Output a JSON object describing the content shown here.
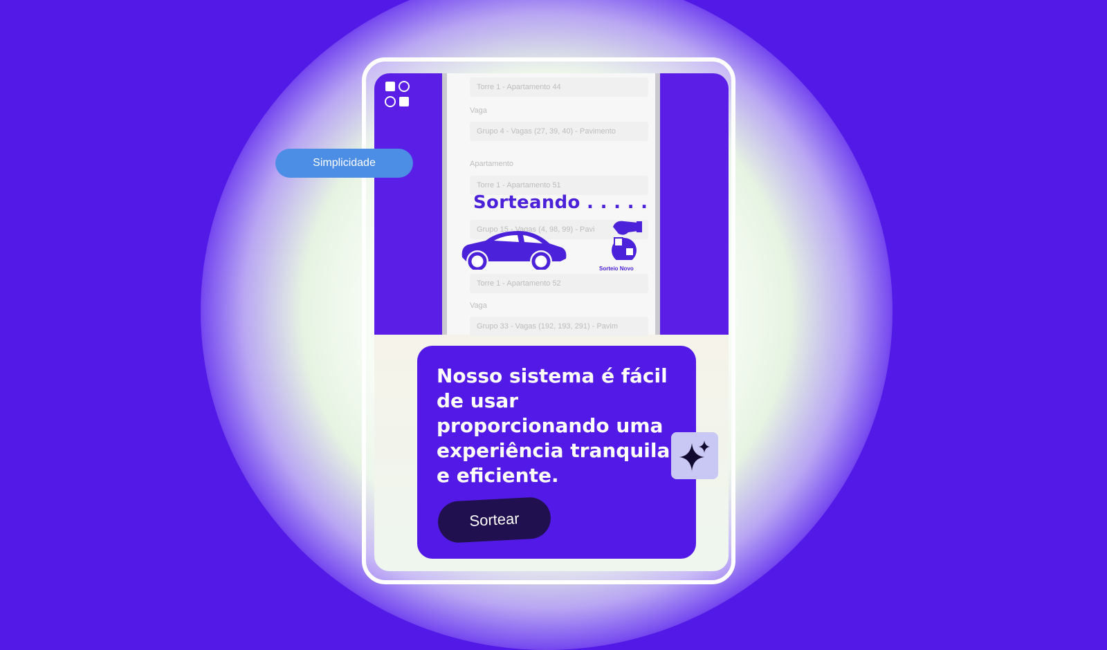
{
  "badge": {
    "label": "Simplicidade"
  },
  "video": {
    "form_rows": [
      {
        "type": "field",
        "text": "Torre 1 - Apartamento 44"
      },
      {
        "type": "label",
        "text": "Vaga"
      },
      {
        "type": "field",
        "text": "Grupo 4 - Vagas (27, 39, 40) - Pavimento"
      },
      {
        "type": "label",
        "text": "Apartamento"
      },
      {
        "type": "field",
        "text": "Torre 1 - Apartamento 51"
      },
      {
        "type": "field",
        "text": "Grupo 15 - Vagas (4, 98, 99) - Pavi"
      },
      {
        "type": "field",
        "text": "Torre 1 - Apartamento 52"
      },
      {
        "type": "label",
        "text": "Vaga"
      },
      {
        "type": "field",
        "text": "Grupo 33 - Vagas (192, 193, 291) - Pavim"
      }
    ],
    "overlay_title": "Sorteando . . . . .",
    "logo_caption": "Sorteio Novo"
  },
  "card": {
    "headline": "Nosso sistema é fácil de usar proporcionando uma experiência tranquila e eficiente.",
    "button_label": "Sortear"
  },
  "icons": {
    "app_logo": "grid-logo-icon",
    "sparkle": "sparkle-icon",
    "car": "car-icon",
    "raffle_logo": "raffle-hand-icon"
  },
  "colors": {
    "background": "#5319e6",
    "card": "#5319e6",
    "pill": "#4c8ee6",
    "button": "#20104f",
    "sparkle_tile": "#c9c8f4"
  }
}
